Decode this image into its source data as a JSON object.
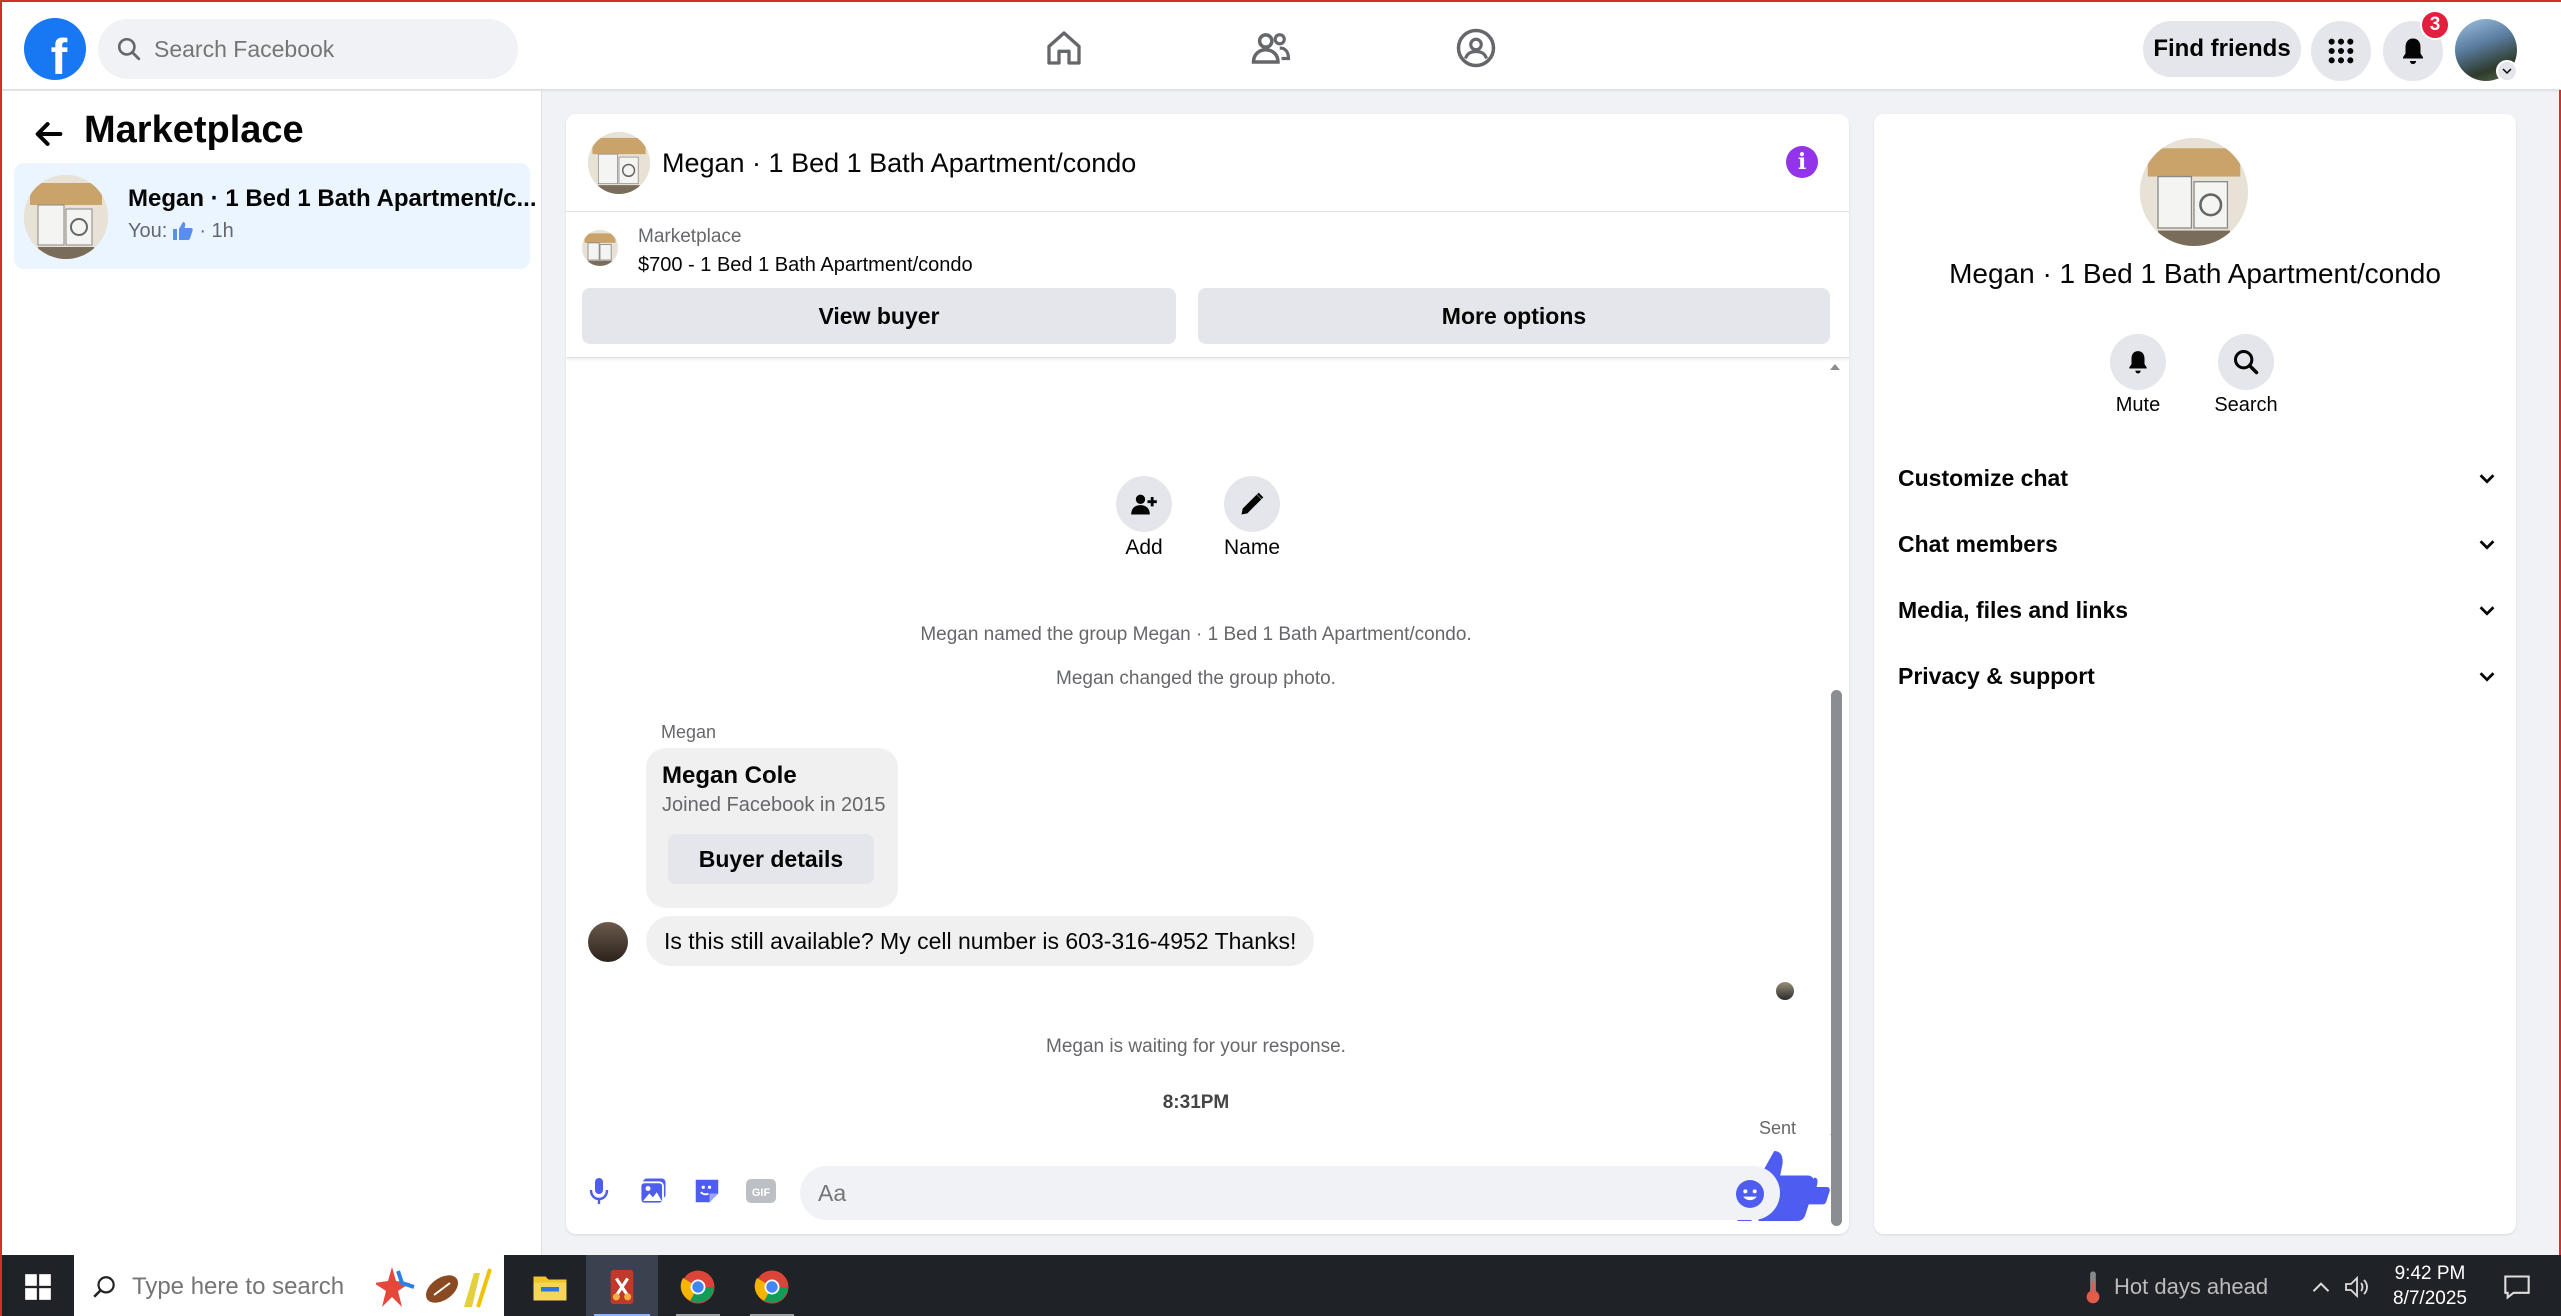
{
  "topbar": {
    "logo_letter": "f",
    "search_placeholder": "Search Facebook",
    "find_friends": "Find friends",
    "notification_count": "3"
  },
  "sidebar": {
    "title": "Marketplace",
    "conversation": {
      "name": "Megan · 1 Bed 1 Bath Apartment/c...",
      "prefix": "You:",
      "time": "· 1h"
    }
  },
  "chat": {
    "title": "Megan · 1 Bed 1 Bath Apartment/condo",
    "info_glyph": "i",
    "listing": {
      "label": "Marketplace",
      "price_title": "$700 - 1 Bed 1 Bath Apartment/condo",
      "view_buyer": "View buyer",
      "more_options": "More options"
    },
    "actions": [
      {
        "label": "Add",
        "icon": "add-person-icon"
      },
      {
        "label": "Name",
        "icon": "pencil-icon"
      }
    ],
    "system_messages": [
      "Megan named the group Megan · 1 Bed 1 Bath Apartment/condo.",
      "Megan changed the group photo."
    ],
    "sender": "Megan",
    "buyer_card": {
      "name": "Megan Cole",
      "joined": "Joined Facebook in 2015",
      "button": "Buyer details"
    },
    "message": "Is this still available? My cell number is 603-316-4952 Thanks!",
    "waiting": "Megan is waiting for your response.",
    "timestamp": "8:31PM",
    "sent_label": "Sent",
    "composer_placeholder": "Aa"
  },
  "info_panel": {
    "title": "Megan · 1 Bed 1 Bath Apartment/condo",
    "mute": "Mute",
    "search": "Search",
    "sections": [
      "Customize chat",
      "Chat members",
      "Media, files and links",
      "Privacy & support"
    ]
  },
  "taskbar": {
    "search_placeholder": "Type here to search",
    "weather": "Hot days ahead",
    "time": "9:42 PM",
    "date": "8/7/2025"
  },
  "colors": {
    "facebook_blue": "#1877f2",
    "like_blue": "#4f5cf0",
    "info_purple": "#9333ea",
    "badge_red": "#e41e3f"
  }
}
